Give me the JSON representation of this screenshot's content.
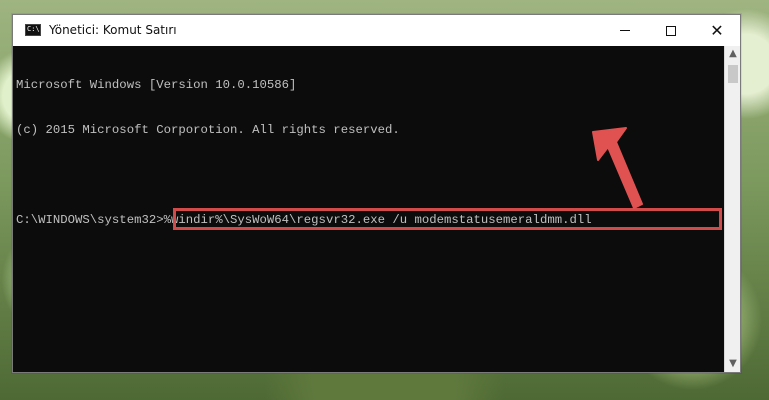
{
  "window": {
    "title": "Yönetici: Komut Satırı",
    "controls": {
      "minimize": "minimize",
      "maximize": "maximize",
      "close": "✕"
    }
  },
  "console": {
    "lines": [
      "Microsoft Windows [Version 10.0.10586]",
      "(c) 2015 Microsoft Corporotion. All rights reserved."
    ],
    "prompt": "C:\\WINDOWS\\system32>",
    "command": "%windir%\\SysWoW64\\regsvr32.exe /u modemstatusemeraldmm.dll"
  },
  "annotation": {
    "highlight_color": "#d14b4b",
    "arrow_color": "#e05252"
  }
}
